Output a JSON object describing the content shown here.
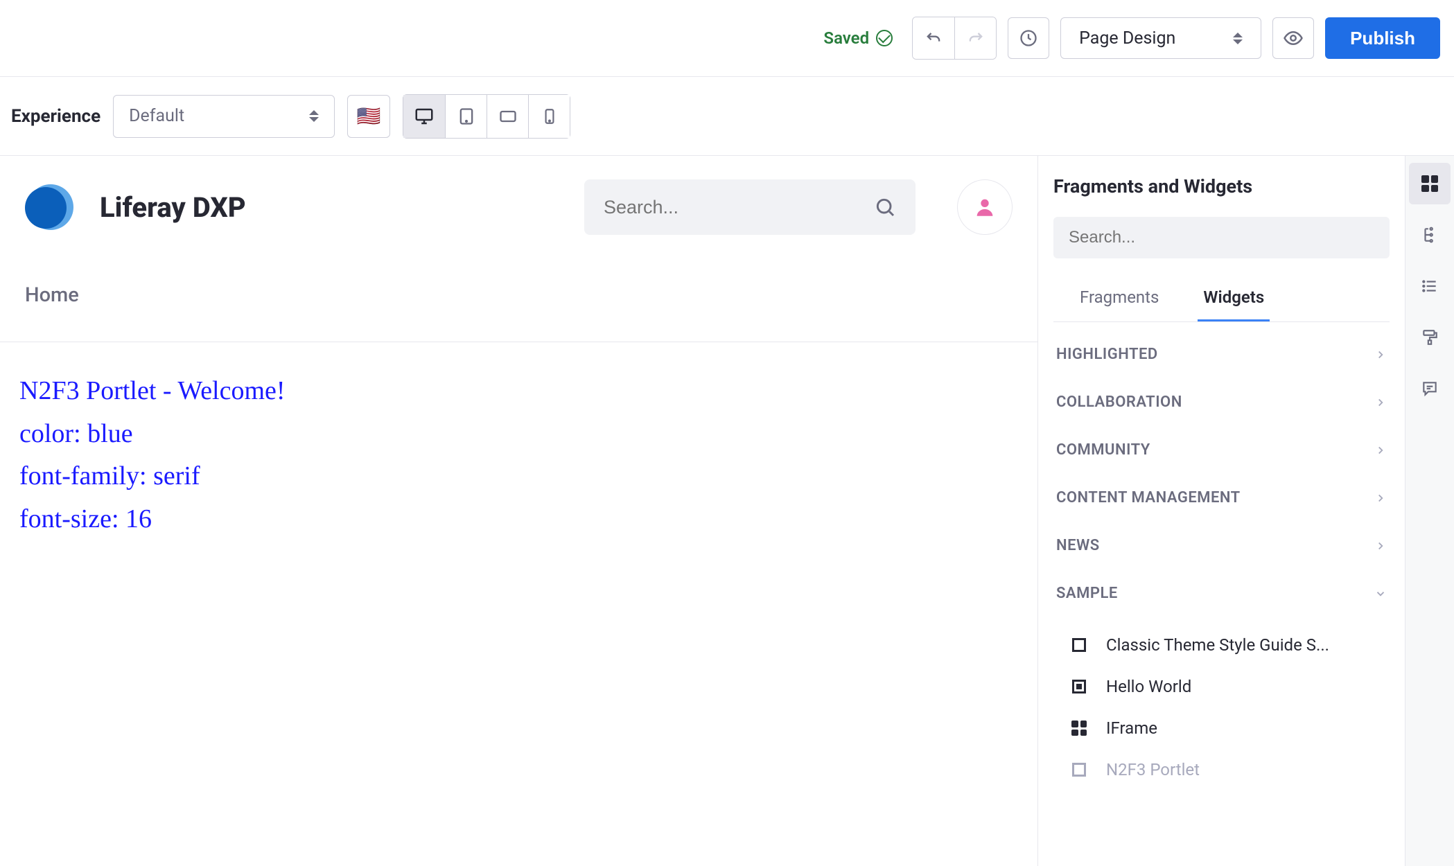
{
  "topbar": {
    "saved_label": "Saved",
    "mode_label": "Page Design",
    "publish_label": "Publish"
  },
  "secondbar": {
    "experience_label": "Experience",
    "experience_value": "Default",
    "locale_flag": "🇺🇸"
  },
  "canvas": {
    "brand": "Liferay DXP",
    "search_placeholder": "Search...",
    "nav_home": "Home",
    "portlet_lines": [
      "N2F3 Portlet - Welcome!",
      "color: blue",
      "font-family: serif",
      "font-size: 16"
    ]
  },
  "sidepanel": {
    "title": "Fragments and Widgets",
    "search_placeholder": "Search...",
    "tab_fragments": "Fragments",
    "tab_widgets": "Widgets",
    "categories": [
      {
        "label": "HIGHLIGHTED",
        "expanded": false
      },
      {
        "label": "COLLABORATION",
        "expanded": false
      },
      {
        "label": "COMMUNITY",
        "expanded": false
      },
      {
        "label": "CONTENT MANAGEMENT",
        "expanded": false
      },
      {
        "label": "NEWS",
        "expanded": false
      },
      {
        "label": "SAMPLE",
        "expanded": true
      }
    ],
    "sample_widgets": [
      {
        "label": "Classic Theme Style Guide S...",
        "icon": "square",
        "disabled": false
      },
      {
        "label": "Hello World",
        "icon": "square-center",
        "disabled": false
      },
      {
        "label": "IFrame",
        "icon": "grid4",
        "disabled": false
      },
      {
        "label": "N2F3 Portlet",
        "icon": "square",
        "disabled": true
      }
    ]
  }
}
